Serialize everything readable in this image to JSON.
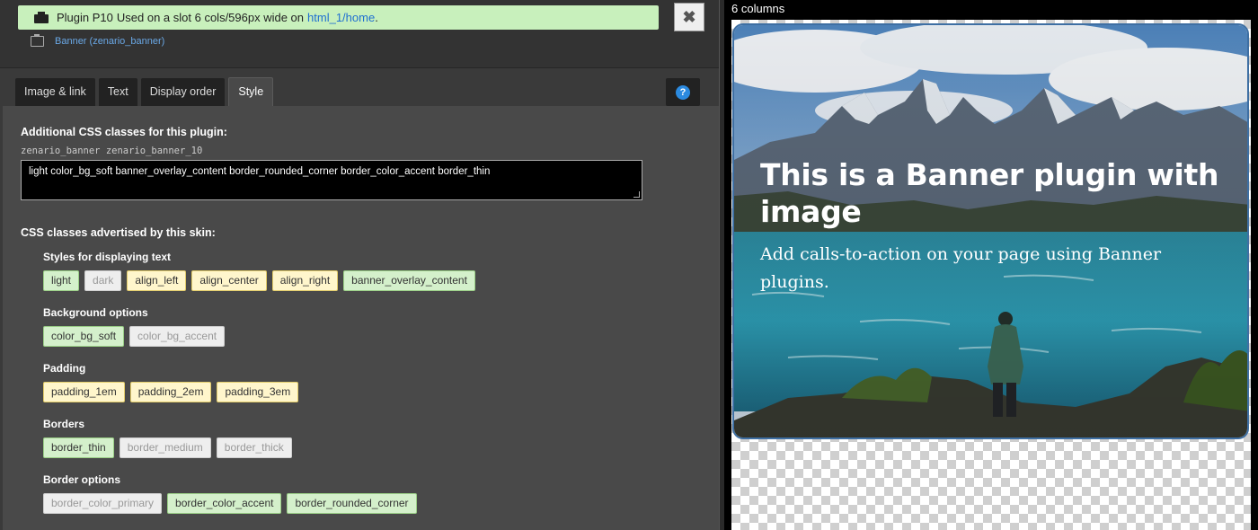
{
  "header": {
    "plugin_id": "Plugin P10",
    "slot_info": "Used on a slot 6 cols/596px wide on",
    "page_link": "html_1/home",
    "close_glyph": "✖",
    "module_name": "Banner (zenario_banner)"
  },
  "tabs": [
    {
      "label": "Image & link"
    },
    {
      "label": "Text"
    },
    {
      "label": "Display order"
    },
    {
      "label": "Style"
    }
  ],
  "help_glyph": "?",
  "form": {
    "additional_label": "Additional CSS classes for this plugin:",
    "base_classes": "zenario_banner zenario_banner_10",
    "css_value": "light color_bg_soft banner_overlay_content border_rounded_corner border_color_accent border_thin",
    "advertised_label": "CSS classes advertised by this skin:",
    "groups": [
      {
        "title": "Styles for displaying text",
        "tags": [
          {
            "label": "light",
            "state": "selected"
          },
          {
            "label": "dark",
            "state": "disabled"
          },
          {
            "label": "align_left",
            "state": "available"
          },
          {
            "label": "align_center",
            "state": "available"
          },
          {
            "label": "align_right",
            "state": "available"
          },
          {
            "label": "banner_overlay_content",
            "state": "selected"
          }
        ]
      },
      {
        "title": "Background options",
        "tags": [
          {
            "label": "color_bg_soft",
            "state": "selected"
          },
          {
            "label": "color_bg_accent",
            "state": "disabled"
          }
        ]
      },
      {
        "title": "Padding",
        "tags": [
          {
            "label": "padding_1em",
            "state": "available"
          },
          {
            "label": "padding_2em",
            "state": "available"
          },
          {
            "label": "padding_3em",
            "state": "available"
          }
        ]
      },
      {
        "title": "Borders",
        "tags": [
          {
            "label": "border_thin",
            "state": "selected"
          },
          {
            "label": "border_medium",
            "state": "disabled"
          },
          {
            "label": "border_thick",
            "state": "disabled"
          }
        ]
      },
      {
        "title": "Border options",
        "tags": [
          {
            "label": "border_color_primary",
            "state": "disabled"
          },
          {
            "label": "border_color_accent",
            "state": "selected"
          },
          {
            "label": "border_rounded_corner",
            "state": "selected"
          }
        ]
      }
    ]
  },
  "preview": {
    "columns_label": "6 columns",
    "banner_title": "This is a Banner plugin with image",
    "banner_text": "Add calls-to-action on your page using Banner plugins."
  },
  "colors": {
    "selected_tag": "#d4f0cb",
    "available_tag": "#fff6cc",
    "disabled_tag": "#eeeeee",
    "plugin_bar": "#c8f0bc",
    "link": "#1f6fd1"
  }
}
